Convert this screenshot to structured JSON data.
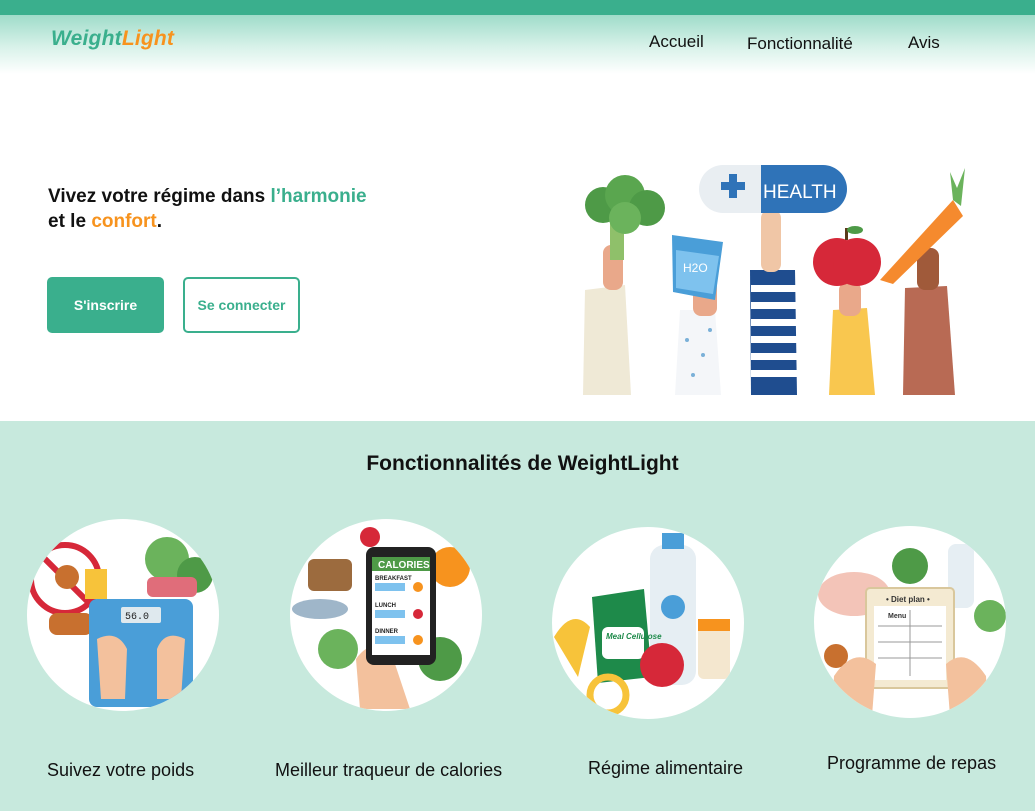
{
  "brand": {
    "part1": "Weight",
    "part2": "Light"
  },
  "nav": {
    "items": [
      "Accueil",
      "Fonctionnalité",
      "Avis"
    ]
  },
  "hero": {
    "line1_prefix": "Vivez votre régime dans ",
    "line1_highlight": "l’harmonie",
    "line2_prefix": "et le ",
    "line2_highlight": "confort",
    "line2_suffix": ".",
    "signup_label": "S'inscrire",
    "login_label": "Se connecter",
    "illustration": {
      "sign_text": "HEALTH",
      "water_label": "H2O"
    }
  },
  "features": {
    "title": "Fonctionnalités de WeightLight",
    "items": [
      {
        "label": "Suivez votre poids",
        "icon": "weight-scale-icon",
        "scale_reading": "56.0"
      },
      {
        "label": "Meilleur traqueur de calories",
        "icon": "calorie-tracker-icon",
        "screen_title": "CALORIES",
        "screen_rows": [
          "BREAKFAST",
          "LUNCH",
          "DINNER"
        ]
      },
      {
        "label": "Régime alimentaire",
        "icon": "diet-food-icon",
        "bag_text": "Meal Cellulose"
      },
      {
        "label": "Programme de repas",
        "icon": "meal-plan-icon",
        "plan_title": "• Diet plan •",
        "plan_menu": "Menu"
      }
    ]
  },
  "colors": {
    "accent": "#3aaf8d",
    "orange": "#f7931e",
    "section_bg": "#c7e9dd"
  }
}
